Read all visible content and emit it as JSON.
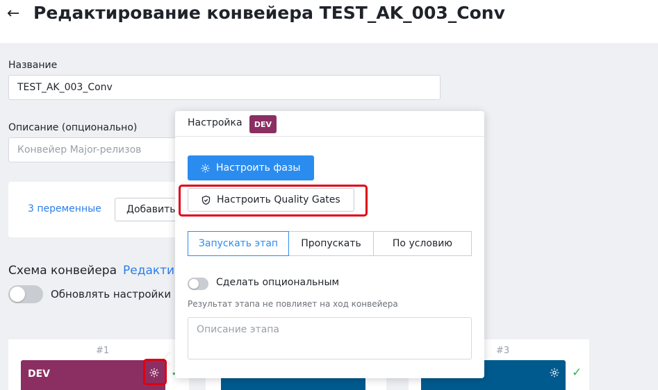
{
  "header": {
    "title": "Редактирование конвейера TEST_AK_003_Conv"
  },
  "form": {
    "name_label": "Название",
    "name_value": "TEST_AK_003_Conv",
    "description_label": "Описание (опционально)",
    "description_placeholder": "Конвейер Major-релизов"
  },
  "variables": {
    "link": "3 переменные",
    "add_button": "Добавить"
  },
  "schema": {
    "label": "Схема конвейера",
    "edit_link": "Редактир",
    "update_toggle_label": "Обновлять настройки в"
  },
  "stages": [
    {
      "number": "#1",
      "name": "DEV",
      "color": "#8b2f62"
    },
    {
      "number": "",
      "name": "",
      "color": "#005a8e"
    },
    {
      "number": "#3",
      "name": "",
      "color": "#005a8e"
    }
  ],
  "popup": {
    "title": "Настройка",
    "badge": "DEV",
    "configure_phases": "Настроить фазы",
    "configure_quality_gates": "Настроить Quality Gates",
    "run_modes": [
      "Запускать этап",
      "Пропускать",
      "По условию"
    ],
    "active_mode_index": 0,
    "optional_label": "Сделать опциональным",
    "optional_hint": "Результат этапа не повлияет на ход конвейера",
    "stage_description_placeholder": "Описание этапа"
  },
  "colors": {
    "accent": "#2b8cf0",
    "dev_badge": "#8b2f62",
    "stage_blue": "#005a8e",
    "highlight": "#e0000f",
    "success": "#34b24a"
  }
}
